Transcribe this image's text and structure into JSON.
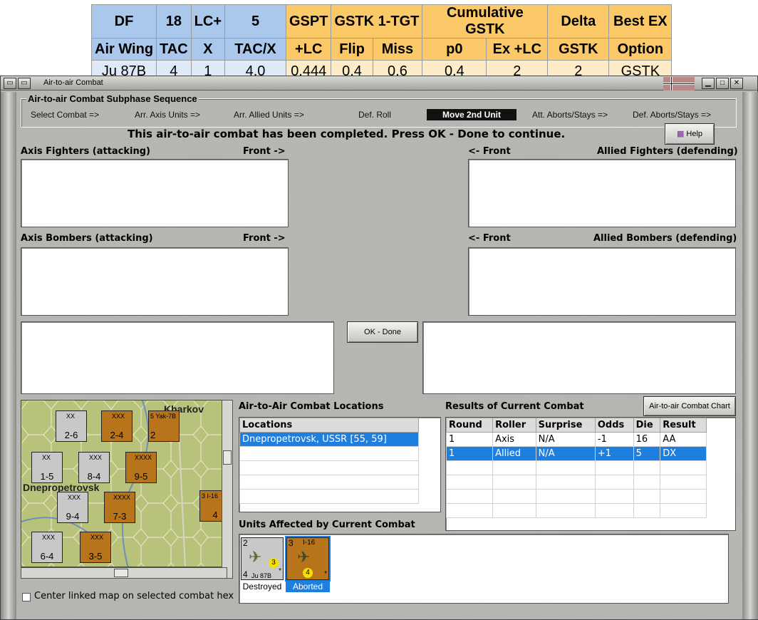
{
  "stats": {
    "headers1": [
      "DF",
      "18",
      "LC+",
      "5",
      "GSPT",
      "GSTK 1-TGT",
      "Cumulative GSTK",
      "Delta",
      "Best EX"
    ],
    "headers2": [
      "Air Wing",
      "TAC",
      "X",
      "TAC/X",
      "+LC",
      "Flip",
      "Miss",
      "p0",
      "Ex +LC",
      "GSTK",
      "Option"
    ],
    "row": [
      "Ju 87B",
      "4",
      "1",
      "4.0",
      "0.444",
      "0.4",
      "0.6",
      "0.4",
      "2",
      "2",
      "GSTK"
    ]
  },
  "window": {
    "title": "Air-to-air Combat",
    "sequence_title": "Air-to-air Combat Subphase Sequence",
    "sequence": [
      "Select Combat =>",
      "Arr. Axis Units =>",
      "Arr. Allied Units =>",
      "Def. Roll",
      "Move 2nd Unit",
      "Att. Aborts/Stays =>",
      "Def. Aborts/Stays =>"
    ],
    "message": "This air-to-air combat has been completed.  Press OK - Done to continue.",
    "help_label": "Help",
    "axis_fighters": "Axis Fighters (attacking)",
    "axis_fighters_front": "Front ->",
    "allied_fighters_front": "<- Front",
    "allied_fighters": "Allied Fighters (defending)",
    "axis_bombers": "Axis Bombers (attacking)",
    "axis_bombers_front": "Front ->",
    "allied_bombers_front": "<- Front",
    "allied_bombers": "Allied Bombers (defending)",
    "ok_label": "OK - Done",
    "locations_title": "Air-to-Air Combat Locations",
    "locations_header": "Locations",
    "locations": [
      "Dnepropetrovsk, USSR [55, 59]"
    ],
    "results_title": "Results of Current Combat",
    "chart_button": "Air-to-air Combat Chart",
    "results_headers": [
      "Round",
      "Roller",
      "Surprise",
      "Odds",
      "Die",
      "Result"
    ],
    "results_rows": [
      [
        "1",
        "Axis",
        "N/A",
        "-1",
        "16",
        "AA"
      ],
      [
        "1",
        "Allied",
        "N/A",
        "+1",
        "5",
        "DX"
      ]
    ],
    "units_title": "Units Affected by Current Combat",
    "units": [
      {
        "top_left": "2",
        "top": "",
        "center": "3",
        "bottom_left": "4",
        "bottom": "Ju 87B",
        "corner": "*",
        "caption": "Destroyed"
      },
      {
        "top_left": "3",
        "top": "I-16",
        "center": "4",
        "bottom_left": "",
        "bottom": "",
        "corner": "*",
        "caption": "Aborted"
      }
    ],
    "center_map_label": "Center linked map on selected combat hex"
  },
  "map": {
    "city_label_1": "Kharkov",
    "city_label_2": "Dnepropetrovsk",
    "counters": [
      {
        "id": "a",
        "top": "XX",
        "value": "2-6",
        "color": "#c8c8c8"
      },
      {
        "id": "b",
        "top": "XXX",
        "value": "2-4",
        "color": "#b8741a"
      },
      {
        "id": "c",
        "top": "5 Yak-7B",
        "value": "2",
        "color": "#b8741a"
      },
      {
        "id": "d",
        "top": "XX",
        "value": "1-5",
        "color": "#c8c8c8"
      },
      {
        "id": "e",
        "top": "XXX",
        "value": "8-4",
        "color": "#c8c8c8"
      },
      {
        "id": "f",
        "top": "XXXX",
        "value": "9-5",
        "color": "#b8741a"
      },
      {
        "id": "g",
        "top": "XXX",
        "value": "9-4",
        "color": "#c8c8c8"
      },
      {
        "id": "h",
        "top": "XXXX",
        "value": "7-3",
        "color": "#b8741a"
      },
      {
        "id": "i",
        "top": "XXX",
        "value": "6-4",
        "color": "#c8c8c8"
      },
      {
        "id": "j",
        "top": "XXX",
        "value": "3-5",
        "color": "#b8741a"
      },
      {
        "id": "k",
        "top": "3 I-16",
        "value": "4",
        "color": "#b8741a"
      }
    ]
  },
  "colors": {
    "accent": "#1f7fdf",
    "window_bg": "#b7b7b3"
  }
}
